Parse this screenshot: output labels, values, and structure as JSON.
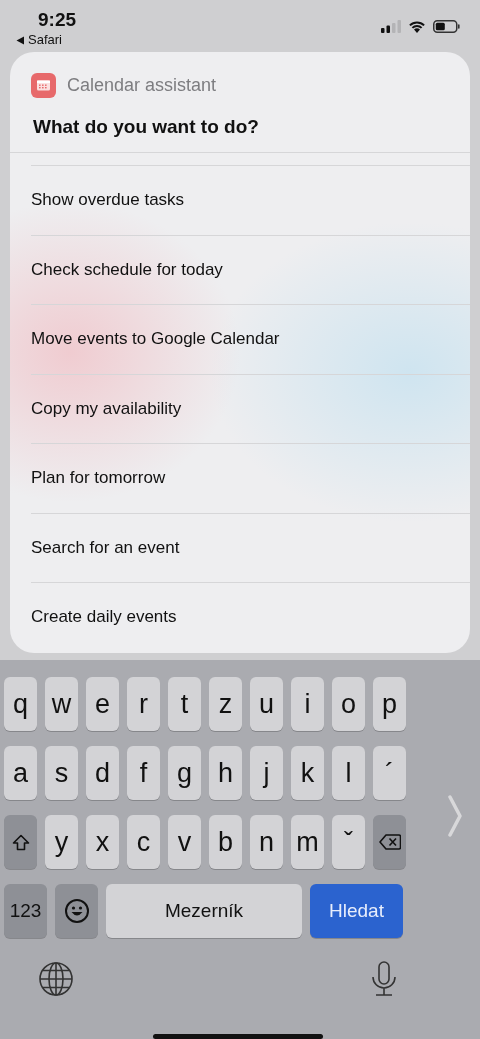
{
  "status_bar": {
    "time": "9:25",
    "back_label": "Safari"
  },
  "card": {
    "app_name": "Calendar assistant",
    "question": "What do you want to do?",
    "items": [
      {
        "label": "Show overdue tasks"
      },
      {
        "label": "Check schedule for today"
      },
      {
        "label": "Move events to Google Calendar"
      },
      {
        "label": "Copy my availability"
      },
      {
        "label": "Plan for tomorrow"
      },
      {
        "label": "Search for an event"
      },
      {
        "label": "Create daily events"
      }
    ]
  },
  "keyboard": {
    "letter_rows": [
      [
        "q",
        "w",
        "e",
        "r",
        "t",
        "z",
        "u",
        "i",
        "o",
        "p"
      ],
      [
        "a",
        "s",
        "d",
        "f",
        "g",
        "h",
        "j",
        "k",
        "l",
        "´"
      ],
      [
        "y",
        "x",
        "c",
        "v",
        "b",
        "n",
        "m",
        "ˇ"
      ]
    ],
    "bottom_row": [
      {
        "kind": "numbers",
        "label": "123"
      },
      {
        "kind": "emoji"
      },
      {
        "kind": "space",
        "label": "Mezerník"
      },
      {
        "kind": "search",
        "label": "Hledat"
      }
    ]
  }
}
